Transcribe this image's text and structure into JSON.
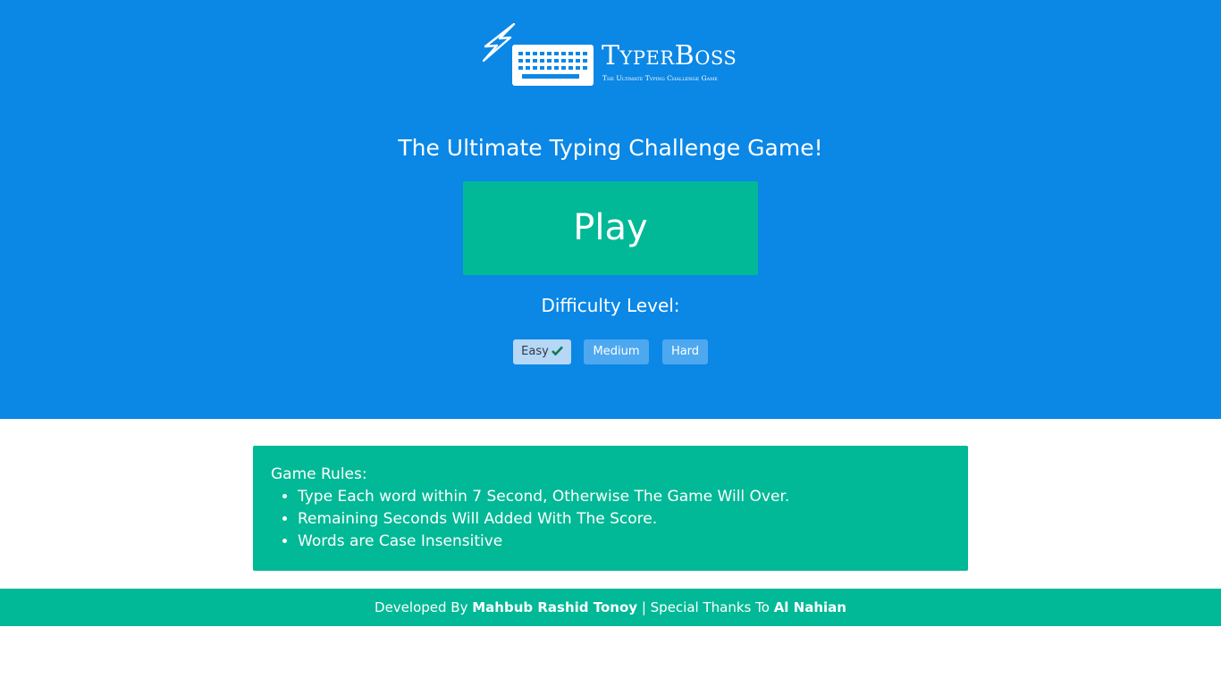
{
  "brand": {
    "name": "TyperBoss",
    "subtitle": "The Ultimate Typing Challenge Game"
  },
  "hero": {
    "tagline": "The Ultimate Typing Challenge Game!",
    "play_label": "Play",
    "difficulty_label": "Difficulty Level:"
  },
  "difficulty": {
    "levels": [
      {
        "label": "Easy",
        "selected": true
      },
      {
        "label": "Medium",
        "selected": false
      },
      {
        "label": "Hard",
        "selected": false
      }
    ]
  },
  "rules": {
    "title": "Game Rules:",
    "items": [
      "Type Each word within 7 Second, Otherwise The Game Will Over.",
      "Remaining Seconds Will Added With The Score.",
      "Words are Case Insensitive"
    ]
  },
  "footer": {
    "developed_by_label": "Developed By",
    "developer": "Mahbub Rashid Tonoy",
    "separator": "|",
    "thanks_label": "Special Thanks To",
    "thanks_name": "Al Nahian"
  },
  "colors": {
    "hero_bg": "#0b87e6",
    "accent_green": "#01b996",
    "level_selected_bg": "#b6d7f5",
    "level_bg": "#4da8f0"
  },
  "icons": {
    "logo": "keyboard-lightning-icon",
    "selected_level": "check-icon"
  }
}
